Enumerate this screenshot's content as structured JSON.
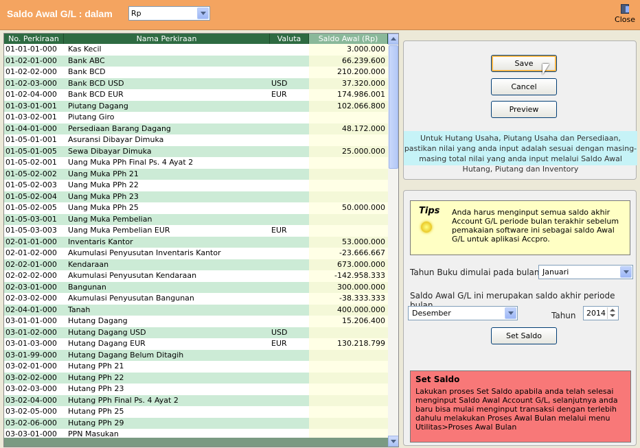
{
  "header": {
    "title": "Saldo Awal G/L : dalam",
    "currency": "Rp",
    "close_label": "Close"
  },
  "columns": [
    "No. Perkiraan",
    "Nama Perkiraan",
    "Valuta",
    "Saldo Awal (Rp)"
  ],
  "rows": [
    [
      "01-01-01-000",
      "Kas Kecil",
      "",
      "3.000.000"
    ],
    [
      "01-02-01-000",
      "Bank ABC",
      "",
      "66.239.600"
    ],
    [
      "01-02-02-000",
      "Bank BCD",
      "",
      "210.200.000"
    ],
    [
      "01-02-03-000",
      "Bank BCD USD",
      "USD",
      "37.320.000"
    ],
    [
      "01-02-04-000",
      "Bank BCD EUR",
      "EUR",
      "174.986.001"
    ],
    [
      "01-03-01-001",
      "Piutang Dagang",
      "",
      "102.066.800"
    ],
    [
      "01-03-02-001",
      "Piutang Giro",
      "",
      ""
    ],
    [
      "01-04-01-000",
      "Persediaan Barang Dagang",
      "",
      "48.172.000"
    ],
    [
      "01-05-01-001",
      "Asuransi Dibayar Dimuka",
      "",
      ""
    ],
    [
      "01-05-01-005",
      "Sewa Dibayar Dimuka",
      "",
      "25.000.000"
    ],
    [
      "01-05-02-001",
      "Uang Muka PPh Final Ps. 4 Ayat 2",
      "",
      ""
    ],
    [
      "01-05-02-002",
      "Uang Muka PPh 21",
      "",
      ""
    ],
    [
      "01-05-02-003",
      "Uang Muka PPh 22",
      "",
      ""
    ],
    [
      "01-05-02-004",
      "Uang Muka PPh 23",
      "",
      ""
    ],
    [
      "01-05-02-005",
      "Uang Muka PPh 25",
      "",
      "50.000.000"
    ],
    [
      "01-05-03-001",
      "Uang Muka Pembelian",
      "",
      ""
    ],
    [
      "01-05-03-003",
      "Uang Muka Pembelian EUR",
      "EUR",
      ""
    ],
    [
      "02-01-01-000",
      "Inventaris Kantor",
      "",
      "53.000.000"
    ],
    [
      "02-01-02-000",
      "Akumulasi Penyusutan Inventaris Kantor",
      "",
      "-23.666.667"
    ],
    [
      "02-02-01-000",
      "Kendaraan",
      "",
      "673.000.000"
    ],
    [
      "02-02-02-000",
      "Akumulasi Penyusutan Kendaraan",
      "",
      "-142.958.333"
    ],
    [
      "02-03-01-000",
      "Bangunan",
      "",
      "300.000.000"
    ],
    [
      "02-03-02-000",
      "Akumulasi Penyusutan Bangunan",
      "",
      "-38.333.333"
    ],
    [
      "02-04-01-000",
      "Tanah",
      "",
      "400.000.000"
    ],
    [
      "03-01-01-000",
      "Hutang Dagang",
      "",
      "15.206.400"
    ],
    [
      "03-01-02-000",
      "Hutang Dagang USD",
      "USD",
      ""
    ],
    [
      "03-01-03-000",
      "Hutang Dagang EUR",
      "EUR",
      "130.218.799"
    ],
    [
      "03-01-99-000",
      "Hutang Dagang Belum Ditagih",
      "",
      ""
    ],
    [
      "03-02-01-000",
      "Hutang PPh 21",
      "",
      ""
    ],
    [
      "03-02-02-000",
      "Hutang PPh 22",
      "",
      ""
    ],
    [
      "03-02-03-000",
      "Hutang PPh 23",
      "",
      ""
    ],
    [
      "03-02-04-000",
      "Hutang PPh Final  Ps. 4 Ayat 2",
      "",
      ""
    ],
    [
      "03-02-05-000",
      "Hutang PPh 25",
      "",
      ""
    ],
    [
      "03-02-06-000",
      "Hutang PPh 29",
      "",
      ""
    ],
    [
      "03-03-01-000",
      "PPN Masukan",
      "",
      ""
    ]
  ],
  "actions": {
    "save": "Save",
    "cancel": "Cancel",
    "preview": "Preview"
  },
  "info_text": "Untuk Hutang Usaha, Piutang Usaha dan Persediaan, pastikan nilai yang anda input adalah sesuai dengan masing-masing total nilai yang anda input melalui Saldo Awal Hutang, Piutang dan Inventory",
  "tips": {
    "title": "Tips",
    "text": "Anda harus menginput semua saldo akhir Account G/L periode bulan terakhir sebelum pemakaian software  ini  sebagai saldo Awal G/L untuk aplikasi Accpro."
  },
  "period": {
    "start_label": "Tahun Buku dimulai pada bulan",
    "start_month": "Januari",
    "end_label": "Saldo Awal G/L ini merupakan saldo akhir periode bulan",
    "end_month": "Desember",
    "year_label": "Tahun",
    "year": "2014",
    "set_button": "Set Saldo"
  },
  "warning": {
    "title": "Set Saldo",
    "text": "Lakukan proses Set Saldo apabila anda telah selesai menginput Saldo Awal Account G/L, selanjutnya anda baru bisa mulai menginput transaksi dengan terlebih dahulu melakukan Proses Awal Bulan melalui menu Utilitas>Proses Awal Bulan"
  },
  "colors": {
    "header": "#f4a460",
    "grid_header": "#2e6b42",
    "row_alt": "#ccebd6",
    "info_bg": "#c6f3f7",
    "tips_bg": "#ffffc4",
    "warning_bg": "#f87878"
  }
}
